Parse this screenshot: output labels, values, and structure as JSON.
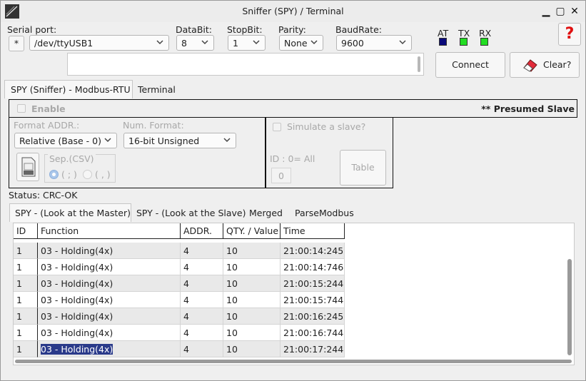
{
  "window": {
    "title": "Sniffer (SPY) / Terminal"
  },
  "serial": {
    "port_label": "Serial port:",
    "star_label": "*",
    "port_value": "/dev/ttyUSB1",
    "databit_label": "DataBit:",
    "databit_value": "8",
    "stopbit_label": "StopBit:",
    "stopbit_value": "1",
    "parity_label": "Parity:",
    "parity_value": "None",
    "baud_label": "BaudRate:",
    "baud_value": "9600"
  },
  "leds": {
    "at_label": "AT",
    "tx_label": "TX",
    "rx_label": "RX",
    "at_color": "#0a0a7a",
    "tx_color": "#22dd22",
    "rx_color": "#22dd22"
  },
  "buttons": {
    "help": "?",
    "connect": "Connect",
    "clear": "Clear?"
  },
  "main_tabs": [
    "SPY (Sniffer) - Modbus-RTU",
    "Terminal"
  ],
  "spy": {
    "enable_label": "Enable",
    "presumed_slave": "** Presumed Slave",
    "format_addr_label": "Format  ADDR.:",
    "format_addr_value": "Relative (Base - 0)",
    "num_format_label": "Num. Format:",
    "num_format_value": "16-bit Unsigned",
    "sep_label": "Sep.(CSV)",
    "sep_opt1": "( ; )",
    "sep_opt2": "( , )",
    "simulate_label": "Simulate a slave?",
    "id_label": "ID : 0= All",
    "id_value": "0",
    "table_button": "Table"
  },
  "status": {
    "text": "Status: CRC-OK"
  },
  "sub_tabs": [
    "SPY - (Look at the Master)",
    "SPY - (Look at the Slave)",
    "Merged",
    "ParseModbus"
  ],
  "table": {
    "columns": [
      "ID",
      "Function",
      "ADDR.",
      "QTY. /  Value",
      "Time"
    ],
    "rows": [
      [
        "1",
        "03 - Holding(4x)",
        "4",
        "10",
        "21:00:14:245"
      ],
      [
        "1",
        "03 - Holding(4x)",
        "4",
        "10",
        "21:00:14:746"
      ],
      [
        "1",
        "03 - Holding(4x)",
        "4",
        "10",
        "21:00:15:244"
      ],
      [
        "1",
        "03 - Holding(4x)",
        "4",
        "10",
        "21:00:15:744"
      ],
      [
        "1",
        "03 - Holding(4x)",
        "4",
        "10",
        "21:00:16:245"
      ],
      [
        "1",
        "03 - Holding(4x)",
        "4",
        "10",
        "21:00:16:744"
      ],
      [
        "1",
        "03 - Holding(4x)",
        "4",
        "10",
        "21:00:17:244"
      ]
    ],
    "selected_row": 6,
    "selection_color": "#2a3a8a"
  }
}
